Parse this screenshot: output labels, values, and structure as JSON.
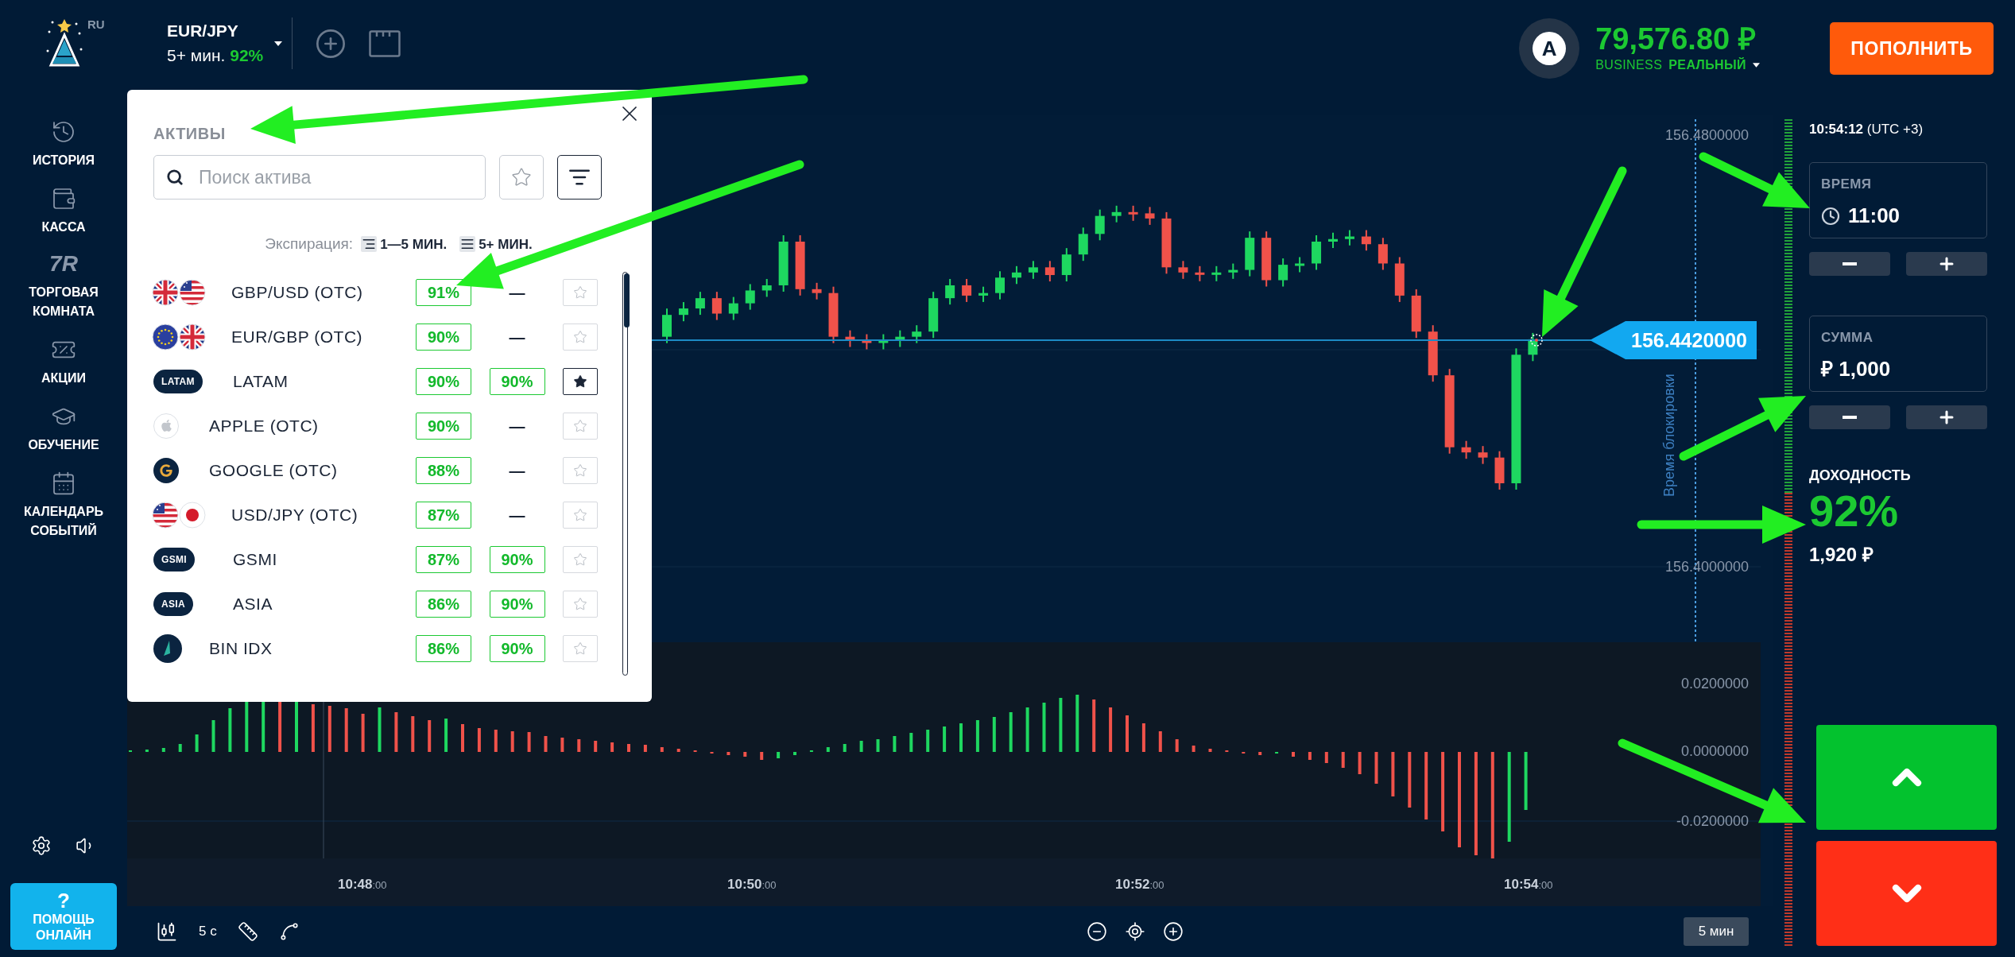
{
  "header": {
    "language": "RU",
    "asset": {
      "name": "EUR/JPY",
      "expiry": "5+ мин.",
      "payout": "92%"
    },
    "balance": {
      "avatar": "A",
      "amount": "79,576.80 ₽",
      "account_type": "BUSINESS",
      "account_mode": "РЕАЛЬНЫЙ"
    },
    "deposit_button": "ПОПОЛНИТЬ"
  },
  "sidebar": {
    "items": [
      {
        "label": "ИСТОРИЯ"
      },
      {
        "label": "КАССА"
      },
      {
        "label": "ТОРГОВАЯ КОМНАТА",
        "icon_text": "7R"
      },
      {
        "label": "АКЦИИ"
      },
      {
        "label": "ОБУЧЕНИЕ"
      },
      {
        "label": "КАЛЕНДАРЬ СОБЫТИЙ"
      }
    ],
    "help_button": {
      "icon": "?",
      "label": "ПОМОЩЬ ОНЛАЙН"
    }
  },
  "asset_panel": {
    "title": "АКТИВЫ",
    "search": {
      "placeholder": "Поиск актива"
    },
    "favorites_filter": false,
    "sort_active": true,
    "expiration": {
      "label": "Экспирация:",
      "short": "1—5 МИН.",
      "long": "5+ МИН."
    },
    "rows": [
      {
        "kind": "pair",
        "name": "GBP/USD (OTC)",
        "payout_short": "91%",
        "payout_long": "—",
        "long_available": false,
        "favorite": false
      },
      {
        "kind": "pair",
        "name": "EUR/GBP (OTC)",
        "payout_short": "90%",
        "payout_long": "—",
        "long_available": false,
        "favorite": false
      },
      {
        "kind": "badge",
        "badge": "LATAM",
        "name": "LATAM",
        "payout_short": "90%",
        "payout_long": "90%",
        "long_available": true,
        "favorite": true
      },
      {
        "kind": "logo",
        "name": "APPLE (OTC)",
        "payout_short": "90%",
        "payout_long": "—",
        "long_available": false,
        "favorite": false
      },
      {
        "kind": "logo",
        "name": "GOOGLE (OTC)",
        "payout_short": "88%",
        "payout_long": "—",
        "long_available": false,
        "favorite": false
      },
      {
        "kind": "pair",
        "name": "USD/JPY (OTC)",
        "payout_short": "87%",
        "payout_long": "—",
        "long_available": false,
        "favorite": false
      },
      {
        "kind": "badge",
        "badge": "GSMI",
        "name": "GSMI",
        "payout_short": "87%",
        "payout_long": "90%",
        "long_available": true,
        "favorite": false
      },
      {
        "kind": "badge",
        "badge": "ASIA",
        "name": "ASIA",
        "payout_short": "86%",
        "payout_long": "90%",
        "long_available": true,
        "favorite": false
      },
      {
        "kind": "logo",
        "name": "BIN IDX",
        "payout_short": "86%",
        "payout_long": "90%",
        "long_available": true,
        "favorite": false
      }
    ]
  },
  "chart": {
    "price_ticks": [
      "156.4800000",
      "156.4000000"
    ],
    "current_price": "156.4420000",
    "lock_label": "Время блокировки",
    "indicator_ticks": [
      "0.0200000",
      "0.0000000",
      "-0.0200000"
    ],
    "time_ticks": [
      {
        "time": "10:48",
        "seconds": ":00"
      },
      {
        "time": "10:50",
        "seconds": ":00"
      },
      {
        "time": "10:52",
        "seconds": ":00"
      },
      {
        "time": "10:54",
        "seconds": ":00"
      }
    ]
  },
  "toolbar": {
    "interval": "5 с",
    "timeframe": "5 мин"
  },
  "trade_panel": {
    "server_time": "10:54:12",
    "timezone": "(UTC +3)",
    "time": {
      "label": "ВРЕМЯ",
      "value": "11:00"
    },
    "amount": {
      "label": "СУММА",
      "value": "₽ 1,000"
    },
    "payout_label": "ДОХОДНОСТЬ",
    "payout": "92%",
    "profit": "1,920 ₽"
  }
}
